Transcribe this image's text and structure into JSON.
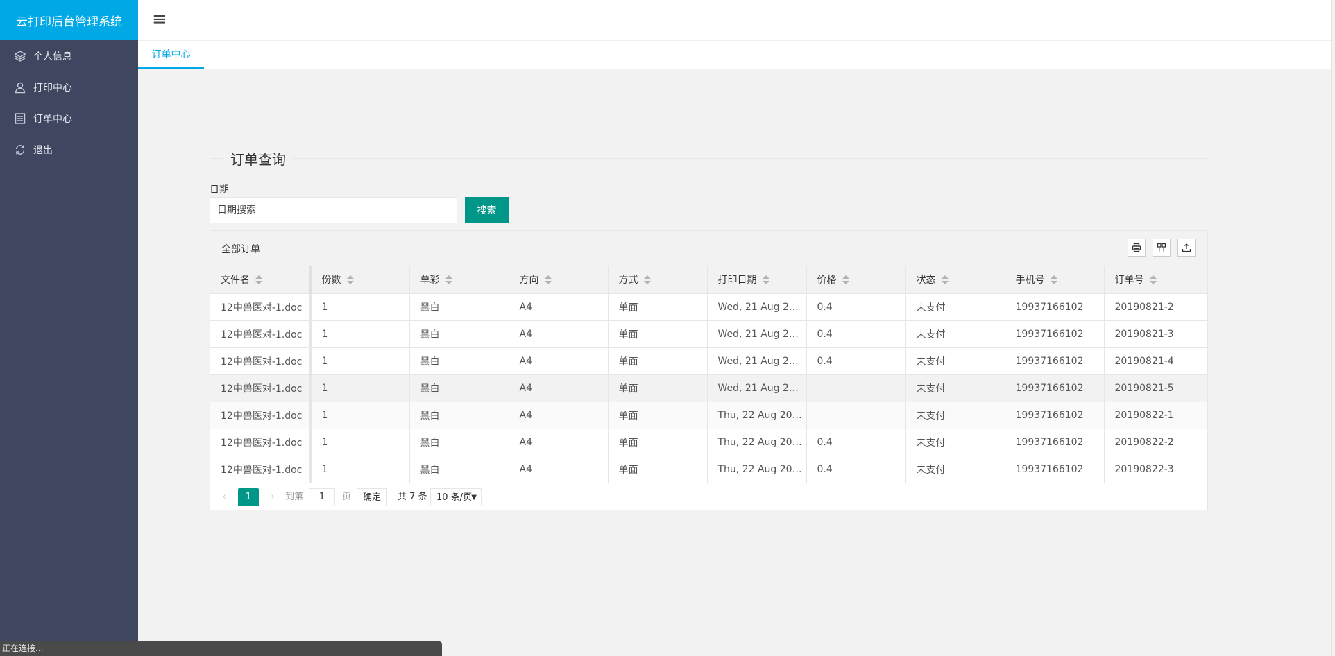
{
  "app": {
    "title": "云打印后台管理系统"
  },
  "sidebar": {
    "items": [
      {
        "label": "个人信息",
        "icon": "layers-icon"
      },
      {
        "label": "打印中心",
        "icon": "user-icon"
      },
      {
        "label": "订单中心",
        "icon": "document-icon"
      },
      {
        "label": "退出",
        "icon": "refresh-icon"
      }
    ]
  },
  "header": {
    "menu_icon": "≡"
  },
  "tabs": [
    {
      "label": "订单中心",
      "active": true
    }
  ],
  "search": {
    "section_title": "订单查询",
    "date_label": "日期",
    "placeholder": "日期搜索",
    "button_label": "搜索"
  },
  "table": {
    "caption": "全部订单",
    "toolbar_icons": [
      "print-icon",
      "columns-icon",
      "export-icon"
    ],
    "columns": [
      "文件名",
      "份数",
      "单彩",
      "方向",
      "方式",
      "打印日期",
      "价格",
      "状态",
      "手机号",
      "订单号"
    ],
    "rows": [
      [
        "12中兽医对-1.doc",
        "1",
        "黑白",
        "A4",
        "单面",
        "Wed, 21 Aug 2…",
        "0.4",
        "未支付",
        "19937166102",
        "20190821-2"
      ],
      [
        "12中兽医对-1.doc",
        "1",
        "黑白",
        "A4",
        "单面",
        "Wed, 21 Aug 2…",
        "0.4",
        "未支付",
        "19937166102",
        "20190821-3"
      ],
      [
        "12中兽医对-1.doc",
        "1",
        "黑白",
        "A4",
        "单面",
        "Wed, 21 Aug 2…",
        "0.4",
        "未支付",
        "19937166102",
        "20190821-4"
      ],
      [
        "12中兽医对-1.doc",
        "1",
        "黑白",
        "A4",
        "单面",
        "Wed, 21 Aug 2…",
        "",
        "未支付",
        "19937166102",
        "20190821-5"
      ],
      [
        "12中兽医对-1.doc",
        "1",
        "黑白",
        "A4",
        "单面",
        "Thu, 22 Aug 20…",
        "",
        "未支付",
        "19937166102",
        "20190822-1"
      ],
      [
        "12中兽医对-1.doc",
        "1",
        "黑白",
        "A4",
        "单面",
        "Thu, 22 Aug 20…",
        "0.4",
        "未支付",
        "19937166102",
        "20190822-2"
      ],
      [
        "12中兽医对-1.doc",
        "1",
        "黑白",
        "A4",
        "单面",
        "Thu, 22 Aug 20…",
        "0.4",
        "未支付",
        "19937166102",
        "20190822-3"
      ]
    ]
  },
  "pager": {
    "prev": "‹",
    "current": "1",
    "next": "›",
    "goto_label": "到第",
    "goto_value": "1",
    "page_unit": "页",
    "confirm_label": "确定",
    "total_label": "共 7 条",
    "page_size": "10 条/页",
    "page_size_arrow": "▼"
  },
  "statusbar": {
    "text": "正在连接..."
  },
  "colors": {
    "accent": "#00a9e6",
    "primary_button": "#009688",
    "sidebar_bg": "#3f4660"
  }
}
